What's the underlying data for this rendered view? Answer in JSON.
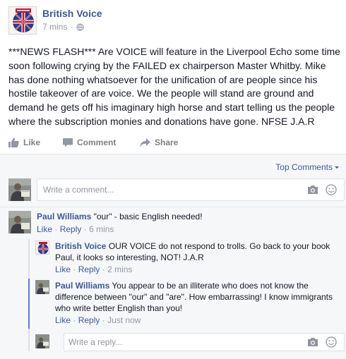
{
  "post": {
    "page_name": "British Voice",
    "time": "7 mins",
    "separator": "·",
    "text": "***NEWS FLASH*** Are VOICE will feature in the Liverpool Echo some time soon following crying by the FAILED ex chairperson Master Whitby. Mike has done nothing whatsoever for the unification of are people since his hostile takeover of are voice. We the people will stand are ground and demand he gets off his imaginary high horse and start telling us the people where the subscription monies and donations have gone. NFSE J.A.R"
  },
  "actions": {
    "like": "Like",
    "comment": "Comment",
    "share": "Share"
  },
  "comments_header": {
    "sort_label": "Top Comments"
  },
  "composer": {
    "placeholder": "Write a comment..."
  },
  "comments": [
    {
      "author": "Paul Williams",
      "text": "\"our\" - basic English needed!",
      "like": "Like",
      "reply": "Reply",
      "time": "6 mins",
      "sep": "·"
    }
  ],
  "replies": [
    {
      "author": "British Voice",
      "text": "OUR VOICE do not respond to trolls. Go back to your book Paul, it looks so interesting, NOT! J.A.R",
      "like": "Like",
      "reply": "Reply",
      "time": "2 mins",
      "sep": "·"
    },
    {
      "author": "Paul Williams",
      "text": "You appear to be an illiterate who does not know the difference between \"our\" and \"are\". How embarrassing! I know immigrants who write better English than you!",
      "like": "Like",
      "reply": "Reply",
      "time": "Just now",
      "sep": "·"
    }
  ],
  "reply_composer": {
    "placeholder": "Write a reply..."
  },
  "colors": {
    "link": "#3b5998",
    "meta": "#9197a3",
    "reply_rule_active": "#5b7bd5",
    "reply_rule": "#dcdee3"
  }
}
